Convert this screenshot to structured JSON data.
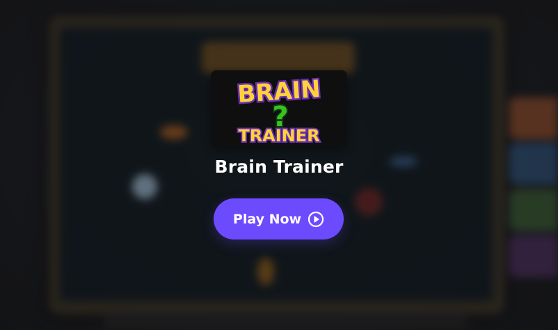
{
  "game": {
    "thumbnail_logo_lines": [
      "BRAIN",
      "?",
      "TRAINER"
    ],
    "title": "Brain Trainer"
  },
  "play_button": {
    "label": "Play Now",
    "icon": "play-circle-icon"
  },
  "colors": {
    "accent": "#6c4bff",
    "logo_yellow": "#ffd23a",
    "logo_purple": "#6a2fb3",
    "logo_green": "#3bc11f"
  }
}
